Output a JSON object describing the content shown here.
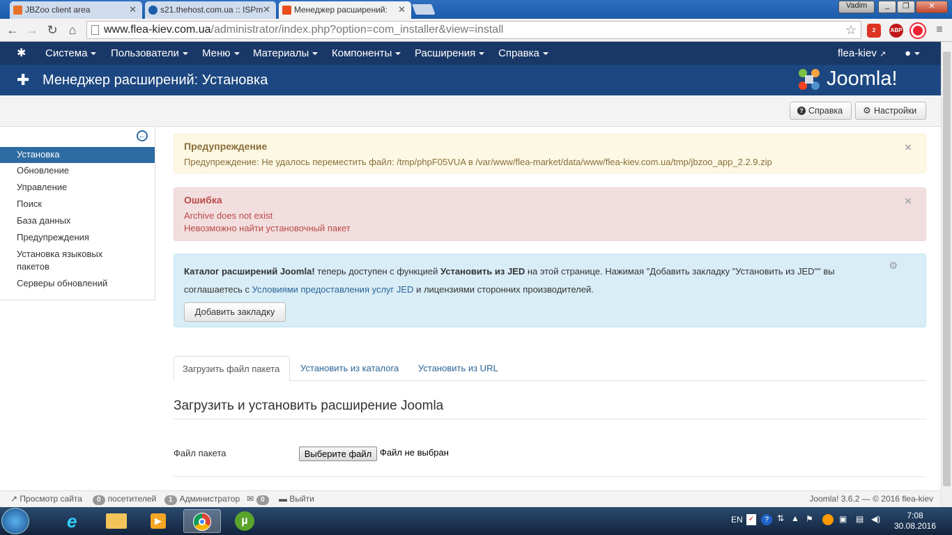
{
  "browser": {
    "tabs": [
      {
        "title": "JBZoo client area",
        "favicon_color": "#e8712a"
      },
      {
        "title": "s21.thehost.com.ua :: ISPm",
        "favicon_color": "#1c5fa8"
      },
      {
        "title": "Менеджер расширений:",
        "favicon_color": "#e94e1b",
        "active": true
      }
    ],
    "window_user": "Vadim",
    "url_host": "www.flea-kiev.com.ua",
    "url_path": "/administrator/index.php?option=com_installer&view=install",
    "ext_badge": "2",
    "ext_abp": "ABP"
  },
  "joomla_nav": {
    "menu": [
      "Система",
      "Пользователи",
      "Меню",
      "Материалы",
      "Компоненты",
      "Расширения",
      "Справка"
    ],
    "site_link": "flea-kiev"
  },
  "header": {
    "title": "Менеджер расширений: Установка",
    "brand": "Joomla!"
  },
  "toolbar": {
    "help": "Справка",
    "options": "Настройки"
  },
  "sidebar": {
    "items": [
      "Установка",
      "Обновление",
      "Управление",
      "Поиск",
      "База данных",
      "Предупреждения",
      "Установка языковых",
      "пакетов",
      "Серверы обновлений"
    ],
    "active_index": 0
  },
  "alerts": {
    "warning_heading": "Предупреждение",
    "warning_text": "Предупреждение: Не удалось переместить файл: /tmp/phpF05VUA в /var/www/flea-market/data/www/flea-kiev.com.ua/tmp/jbzoo_app_2.2.9.zip",
    "error_heading": "Ошибка",
    "error_line1": "Archive does not exist",
    "error_line2": "Невозможно найти установочный пакет",
    "close_symbol": "×",
    "info_bold1": "Каталог расширений Joomla!",
    "info_text1": " теперь доступен с функцией ",
    "info_bold2": "Установить из JED",
    "info_text2": " на этой странице. Нажимая \"Добавить закладку \"Установить из JED\"\" вы соглашаетесь с ",
    "info_link": "Условиями предоставления услуг JED",
    "info_text3": " и лицензиями сторонних производителей.",
    "info_button": "Добавить закладку"
  },
  "tabs": [
    "Загрузить файл пакета",
    "Установить из каталога",
    "Установить из URL"
  ],
  "upload": {
    "legend": "Загрузить и установить расширение Joomla",
    "label": "Файл пакета",
    "button": "Выберите файл",
    "no_file": "Файл не выбран"
  },
  "status": {
    "view_site": "Просмотр сайта",
    "visitors_count": "0",
    "visitors_label": "посетителей",
    "admins_count": "1",
    "admins_label": "Администратор",
    "messages_count": "0",
    "logout": "Выйти",
    "version": "Joomla! 3.6.2  —  © 2016 flea-kiev"
  },
  "taskbar": {
    "lang": "EN",
    "time": "7:08",
    "date": "30.08.2016"
  }
}
